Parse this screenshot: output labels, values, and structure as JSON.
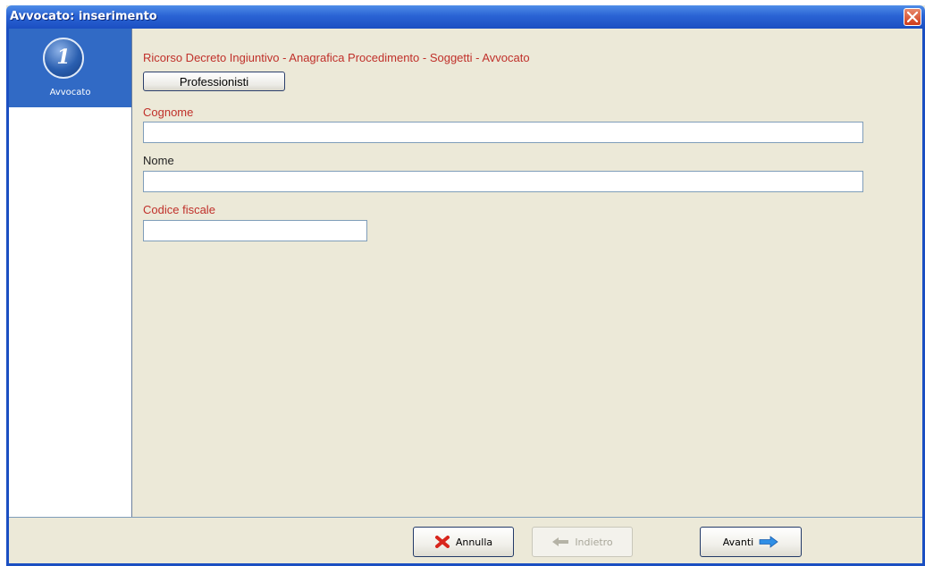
{
  "window": {
    "title": "Avvocato: inserimento"
  },
  "sidebar": {
    "steps": [
      {
        "number": "1",
        "label": "Avvocato",
        "active": true
      }
    ]
  },
  "main": {
    "breadcrumb": "Ricorso Decreto Ingiuntivo - Anagrafica Procedimento - Soggetti - Avvocato",
    "professionisti_button": "Professionisti",
    "fields": {
      "cognome": {
        "label": "Cognome",
        "required": true,
        "value": ""
      },
      "nome": {
        "label": "Nome",
        "required": false,
        "value": ""
      },
      "codice_fiscale": {
        "label": "Codice fiscale",
        "required": true,
        "value": ""
      }
    }
  },
  "footer": {
    "annulla_label": "Annulla",
    "indietro_label": "Indietro",
    "avanti_label": "Avanti",
    "indietro_enabled": false
  },
  "colors": {
    "titlebar": "#1b4fc2",
    "window_background": "#ece9d8",
    "required_label": "#c0302a",
    "active_step": "#316ac5"
  },
  "icons": {
    "close": "close-x-icon",
    "annulla": "red-x-icon",
    "indietro": "arrow-left-icon",
    "avanti": "arrow-right-icon"
  }
}
